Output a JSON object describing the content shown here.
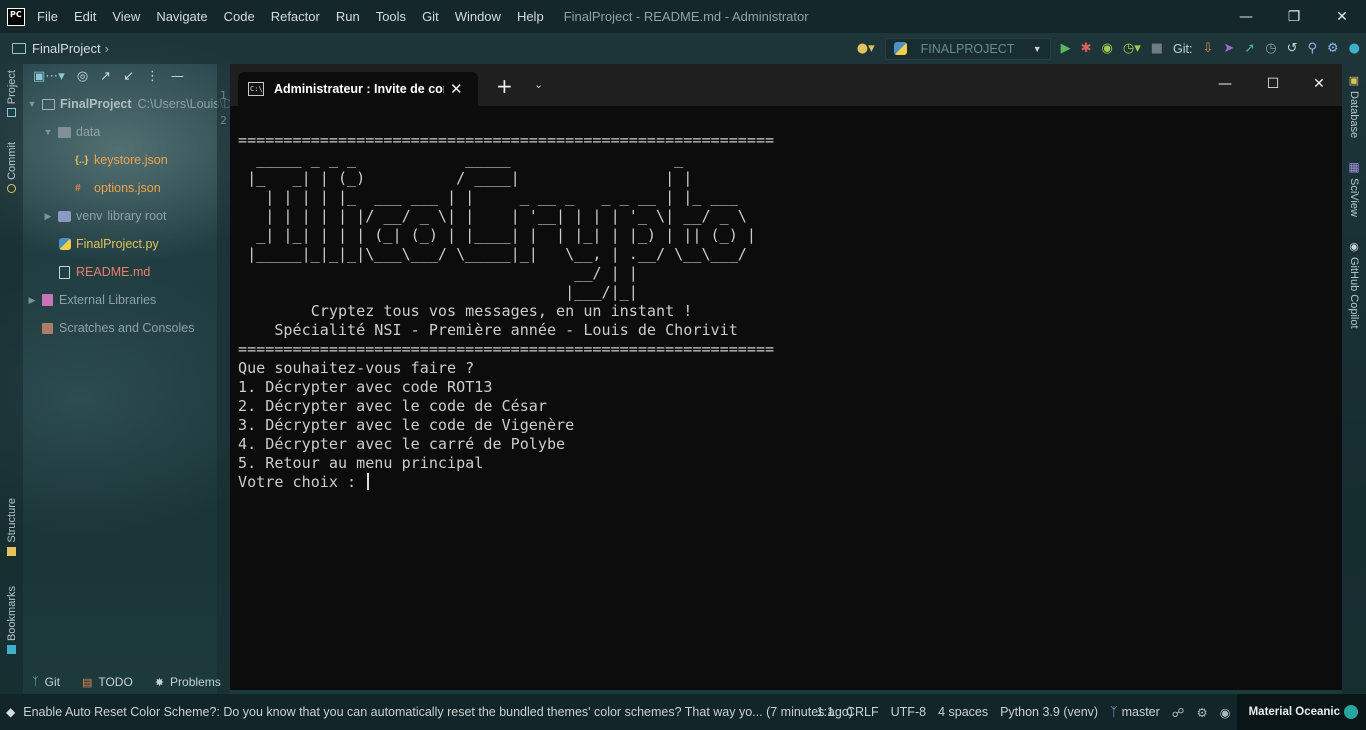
{
  "menubar": {
    "logo": "PC",
    "items": [
      "File",
      "Edit",
      "View",
      "Navigate",
      "Code",
      "Refactor",
      "Run",
      "Tools",
      "Git",
      "Window",
      "Help"
    ],
    "window_title": "FinalProject - README.md - Administrator"
  },
  "navbar": {
    "breadcrumb": "FinalProject",
    "run_config": "FINALPROJECT",
    "git_label": "Git:"
  },
  "left_stripe": {
    "tabs": [
      "Project",
      "Commit",
      "Structure",
      "Bookmarks"
    ]
  },
  "project_tree": {
    "root": {
      "name": "FinalProject",
      "path": "C:\\Users\\Louis\\D"
    },
    "data_folder": "data",
    "keystore": "keystore.json",
    "options": "options.json",
    "venv": "venv",
    "venv_suffix": "library root",
    "main_py": "FinalProject.py",
    "readme": "README.md",
    "external_libraries": "External Libraries",
    "scratches": "Scratches and Consoles"
  },
  "gutter": {
    "line_numbers": [
      "1",
      "2"
    ]
  },
  "terminal": {
    "tab_title": "Administrateur : Invite de com",
    "lines": [
      "===========================================================",
      "  _____ _ _ _            _____                  _",
      " |_   _| | (_)          / ____|                | |",
      "   | | | | |_  ___ ___ | |     _ __ _   _ _ __ | |_ ___",
      "   | | | | | |/ __/ _ \\| |    | '__| | | | '_ \\| __/ _ \\",
      "  _| |_| | | | (_| (_) | |____| |  | |_| | |_) | || (_) |",
      " |_____|_|_|_|\\___\\___/ \\_____|_|   \\__, | .__/ \\__\\___/",
      "                                     __/ | |",
      "                                    |___/|_|",
      "        Cryptez tous vos messages, en un instant !",
      "    Spécialité NSI - Première année - Louis de Chorivit",
      "===========================================================",
      "",
      "Que souhaitez-vous faire ?",
      "1. Décrypter avec code ROT13",
      "2. Décrypter avec le code de César",
      "3. Décrypter avec le code de Vigenère",
      "4. Décrypter avec le carré de Polybe",
      "5. Retour au menu principal"
    ],
    "prompt": "Votre choix : "
  },
  "right_stripe": {
    "tabs": [
      "Database",
      "SciView",
      "GitHub Copilot"
    ]
  },
  "bottom_tools": {
    "git": "Git",
    "todo": "TODO",
    "problems": "Problems"
  },
  "statusbar": {
    "message": "Enable Auto Reset Color Scheme?: Do you know that you can automatically reset the bundled themes' color schemes? That way yo... (7 minutes ago)",
    "position": "1:1",
    "line_sep": "CRLF",
    "encoding": "UTF-8",
    "indent": "4 spaces",
    "interpreter": "Python 3.9 (venv)",
    "branch": "master",
    "theme": "Material Oceanic"
  },
  "colors": {
    "accent": "#27a6a0",
    "terminal_bg": "#0c0c0c",
    "terminal_fg": "#cccccc"
  }
}
